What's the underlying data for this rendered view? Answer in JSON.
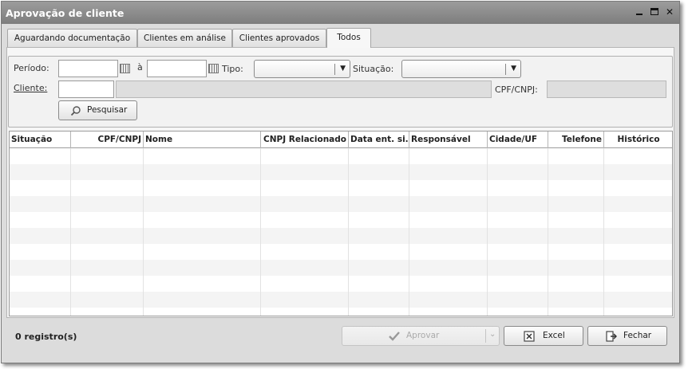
{
  "window": {
    "title": "Aprovação de cliente"
  },
  "tabs": [
    {
      "label": "Aguardando documentação"
    },
    {
      "label": "Clientes em análise"
    },
    {
      "label": "Clientes aprovados"
    },
    {
      "label": "Todos",
      "active": true
    }
  ],
  "filters": {
    "periodo_label": "Período:",
    "periodo_sep": "à",
    "tipo_label": "Tipo:",
    "situacao_label": "Situação:",
    "cliente_label": "Cliente:",
    "cpfcnpj_label": "CPF/CNPJ:",
    "search_label": "Pesquisar",
    "periodo_inicio": "",
    "periodo_fim": "",
    "tipo_value": "",
    "situacao_value": ""
  },
  "grid": {
    "columns": [
      {
        "label": "Situação"
      },
      {
        "label": "CPF/CNPJ"
      },
      {
        "label": "Nome"
      },
      {
        "label": "CNPJ Relacionado"
      },
      {
        "label": "Data ent. si..."
      },
      {
        "label": "Responsável"
      },
      {
        "label": "Cidade/UF"
      },
      {
        "label": "Telefone"
      },
      {
        "label": "Histórico"
      }
    ],
    "rows": []
  },
  "footer": {
    "count_label": "0 registro(s)",
    "aprovar_label": "Aprovar",
    "excel_label": "Excel",
    "fechar_label": "Fechar"
  }
}
